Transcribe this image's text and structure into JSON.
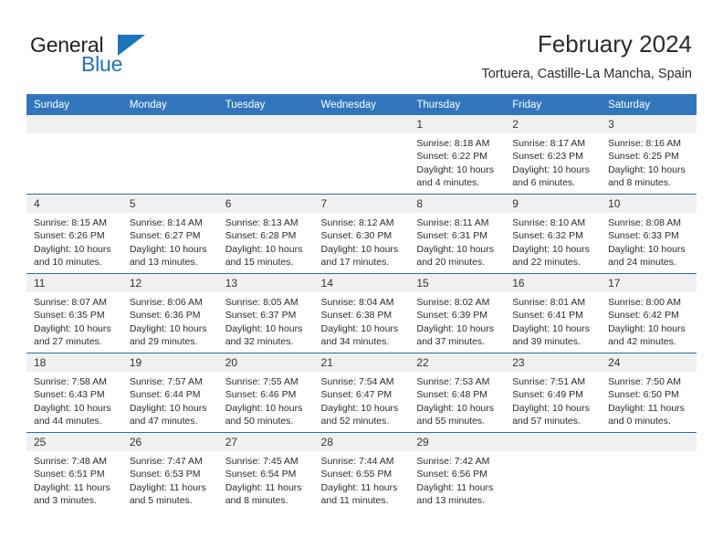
{
  "brand": {
    "name_top": "General",
    "name_bottom": "Blue",
    "accent_color": "#1b75bb"
  },
  "header": {
    "title": "February 2024",
    "subtitle": "Tortuera, Castille-La Mancha, Spain"
  },
  "theme": {
    "header_row_bg": "#3176bc",
    "row_divider": "#2e6da4",
    "daynum_strip_bg": "#f0f0f0"
  },
  "weekday_headers": [
    "Sunday",
    "Monday",
    "Tuesday",
    "Wednesday",
    "Thursday",
    "Friday",
    "Saturday"
  ],
  "labels": {
    "sunrise": "Sunrise:",
    "sunset": "Sunset:",
    "daylight": "Daylight:"
  },
  "weeks": [
    [
      {
        "day": "",
        "blank": true
      },
      {
        "day": "",
        "blank": true
      },
      {
        "day": "",
        "blank": true
      },
      {
        "day": "",
        "blank": true
      },
      {
        "day": "1",
        "sunrise": "Sunrise: 8:18 AM",
        "sunset": "Sunset: 6:22 PM",
        "daylight_1": "Daylight: 10 hours",
        "daylight_2": "and 4 minutes."
      },
      {
        "day": "2",
        "sunrise": "Sunrise: 8:17 AM",
        "sunset": "Sunset: 6:23 PM",
        "daylight_1": "Daylight: 10 hours",
        "daylight_2": "and 6 minutes."
      },
      {
        "day": "3",
        "sunrise": "Sunrise: 8:16 AM",
        "sunset": "Sunset: 6:25 PM",
        "daylight_1": "Daylight: 10 hours",
        "daylight_2": "and 8 minutes."
      }
    ],
    [
      {
        "day": "4",
        "sunrise": "Sunrise: 8:15 AM",
        "sunset": "Sunset: 6:26 PM",
        "daylight_1": "Daylight: 10 hours",
        "daylight_2": "and 10 minutes."
      },
      {
        "day": "5",
        "sunrise": "Sunrise: 8:14 AM",
        "sunset": "Sunset: 6:27 PM",
        "daylight_1": "Daylight: 10 hours",
        "daylight_2": "and 13 minutes."
      },
      {
        "day": "6",
        "sunrise": "Sunrise: 8:13 AM",
        "sunset": "Sunset: 6:28 PM",
        "daylight_1": "Daylight: 10 hours",
        "daylight_2": "and 15 minutes."
      },
      {
        "day": "7",
        "sunrise": "Sunrise: 8:12 AM",
        "sunset": "Sunset: 6:30 PM",
        "daylight_1": "Daylight: 10 hours",
        "daylight_2": "and 17 minutes."
      },
      {
        "day": "8",
        "sunrise": "Sunrise: 8:11 AM",
        "sunset": "Sunset: 6:31 PM",
        "daylight_1": "Daylight: 10 hours",
        "daylight_2": "and 20 minutes."
      },
      {
        "day": "9",
        "sunrise": "Sunrise: 8:10 AM",
        "sunset": "Sunset: 6:32 PM",
        "daylight_1": "Daylight: 10 hours",
        "daylight_2": "and 22 minutes."
      },
      {
        "day": "10",
        "sunrise": "Sunrise: 8:08 AM",
        "sunset": "Sunset: 6:33 PM",
        "daylight_1": "Daylight: 10 hours",
        "daylight_2": "and 24 minutes."
      }
    ],
    [
      {
        "day": "11",
        "sunrise": "Sunrise: 8:07 AM",
        "sunset": "Sunset: 6:35 PM",
        "daylight_1": "Daylight: 10 hours",
        "daylight_2": "and 27 minutes."
      },
      {
        "day": "12",
        "sunrise": "Sunrise: 8:06 AM",
        "sunset": "Sunset: 6:36 PM",
        "daylight_1": "Daylight: 10 hours",
        "daylight_2": "and 29 minutes."
      },
      {
        "day": "13",
        "sunrise": "Sunrise: 8:05 AM",
        "sunset": "Sunset: 6:37 PM",
        "daylight_1": "Daylight: 10 hours",
        "daylight_2": "and 32 minutes."
      },
      {
        "day": "14",
        "sunrise": "Sunrise: 8:04 AM",
        "sunset": "Sunset: 6:38 PM",
        "daylight_1": "Daylight: 10 hours",
        "daylight_2": "and 34 minutes."
      },
      {
        "day": "15",
        "sunrise": "Sunrise: 8:02 AM",
        "sunset": "Sunset: 6:39 PM",
        "daylight_1": "Daylight: 10 hours",
        "daylight_2": "and 37 minutes."
      },
      {
        "day": "16",
        "sunrise": "Sunrise: 8:01 AM",
        "sunset": "Sunset: 6:41 PM",
        "daylight_1": "Daylight: 10 hours",
        "daylight_2": "and 39 minutes."
      },
      {
        "day": "17",
        "sunrise": "Sunrise: 8:00 AM",
        "sunset": "Sunset: 6:42 PM",
        "daylight_1": "Daylight: 10 hours",
        "daylight_2": "and 42 minutes."
      }
    ],
    [
      {
        "day": "18",
        "sunrise": "Sunrise: 7:58 AM",
        "sunset": "Sunset: 6:43 PM",
        "daylight_1": "Daylight: 10 hours",
        "daylight_2": "and 44 minutes."
      },
      {
        "day": "19",
        "sunrise": "Sunrise: 7:57 AM",
        "sunset": "Sunset: 6:44 PM",
        "daylight_1": "Daylight: 10 hours",
        "daylight_2": "and 47 minutes."
      },
      {
        "day": "20",
        "sunrise": "Sunrise: 7:55 AM",
        "sunset": "Sunset: 6:46 PM",
        "daylight_1": "Daylight: 10 hours",
        "daylight_2": "and 50 minutes."
      },
      {
        "day": "21",
        "sunrise": "Sunrise: 7:54 AM",
        "sunset": "Sunset: 6:47 PM",
        "daylight_1": "Daylight: 10 hours",
        "daylight_2": "and 52 minutes."
      },
      {
        "day": "22",
        "sunrise": "Sunrise: 7:53 AM",
        "sunset": "Sunset: 6:48 PM",
        "daylight_1": "Daylight: 10 hours",
        "daylight_2": "and 55 minutes."
      },
      {
        "day": "23",
        "sunrise": "Sunrise: 7:51 AM",
        "sunset": "Sunset: 6:49 PM",
        "daylight_1": "Daylight: 10 hours",
        "daylight_2": "and 57 minutes."
      },
      {
        "day": "24",
        "sunrise": "Sunrise: 7:50 AM",
        "sunset": "Sunset: 6:50 PM",
        "daylight_1": "Daylight: 11 hours",
        "daylight_2": "and 0 minutes."
      }
    ],
    [
      {
        "day": "25",
        "sunrise": "Sunrise: 7:48 AM",
        "sunset": "Sunset: 6:51 PM",
        "daylight_1": "Daylight: 11 hours",
        "daylight_2": "and 3 minutes."
      },
      {
        "day": "26",
        "sunrise": "Sunrise: 7:47 AM",
        "sunset": "Sunset: 6:53 PM",
        "daylight_1": "Daylight: 11 hours",
        "daylight_2": "and 5 minutes."
      },
      {
        "day": "27",
        "sunrise": "Sunrise: 7:45 AM",
        "sunset": "Sunset: 6:54 PM",
        "daylight_1": "Daylight: 11 hours",
        "daylight_2": "and 8 minutes."
      },
      {
        "day": "28",
        "sunrise": "Sunrise: 7:44 AM",
        "sunset": "Sunset: 6:55 PM",
        "daylight_1": "Daylight: 11 hours",
        "daylight_2": "and 11 minutes."
      },
      {
        "day": "29",
        "sunrise": "Sunrise: 7:42 AM",
        "sunset": "Sunset: 6:56 PM",
        "daylight_1": "Daylight: 11 hours",
        "daylight_2": "and 13 minutes."
      },
      {
        "day": "",
        "blank": true
      },
      {
        "day": "",
        "blank": true
      }
    ]
  ]
}
